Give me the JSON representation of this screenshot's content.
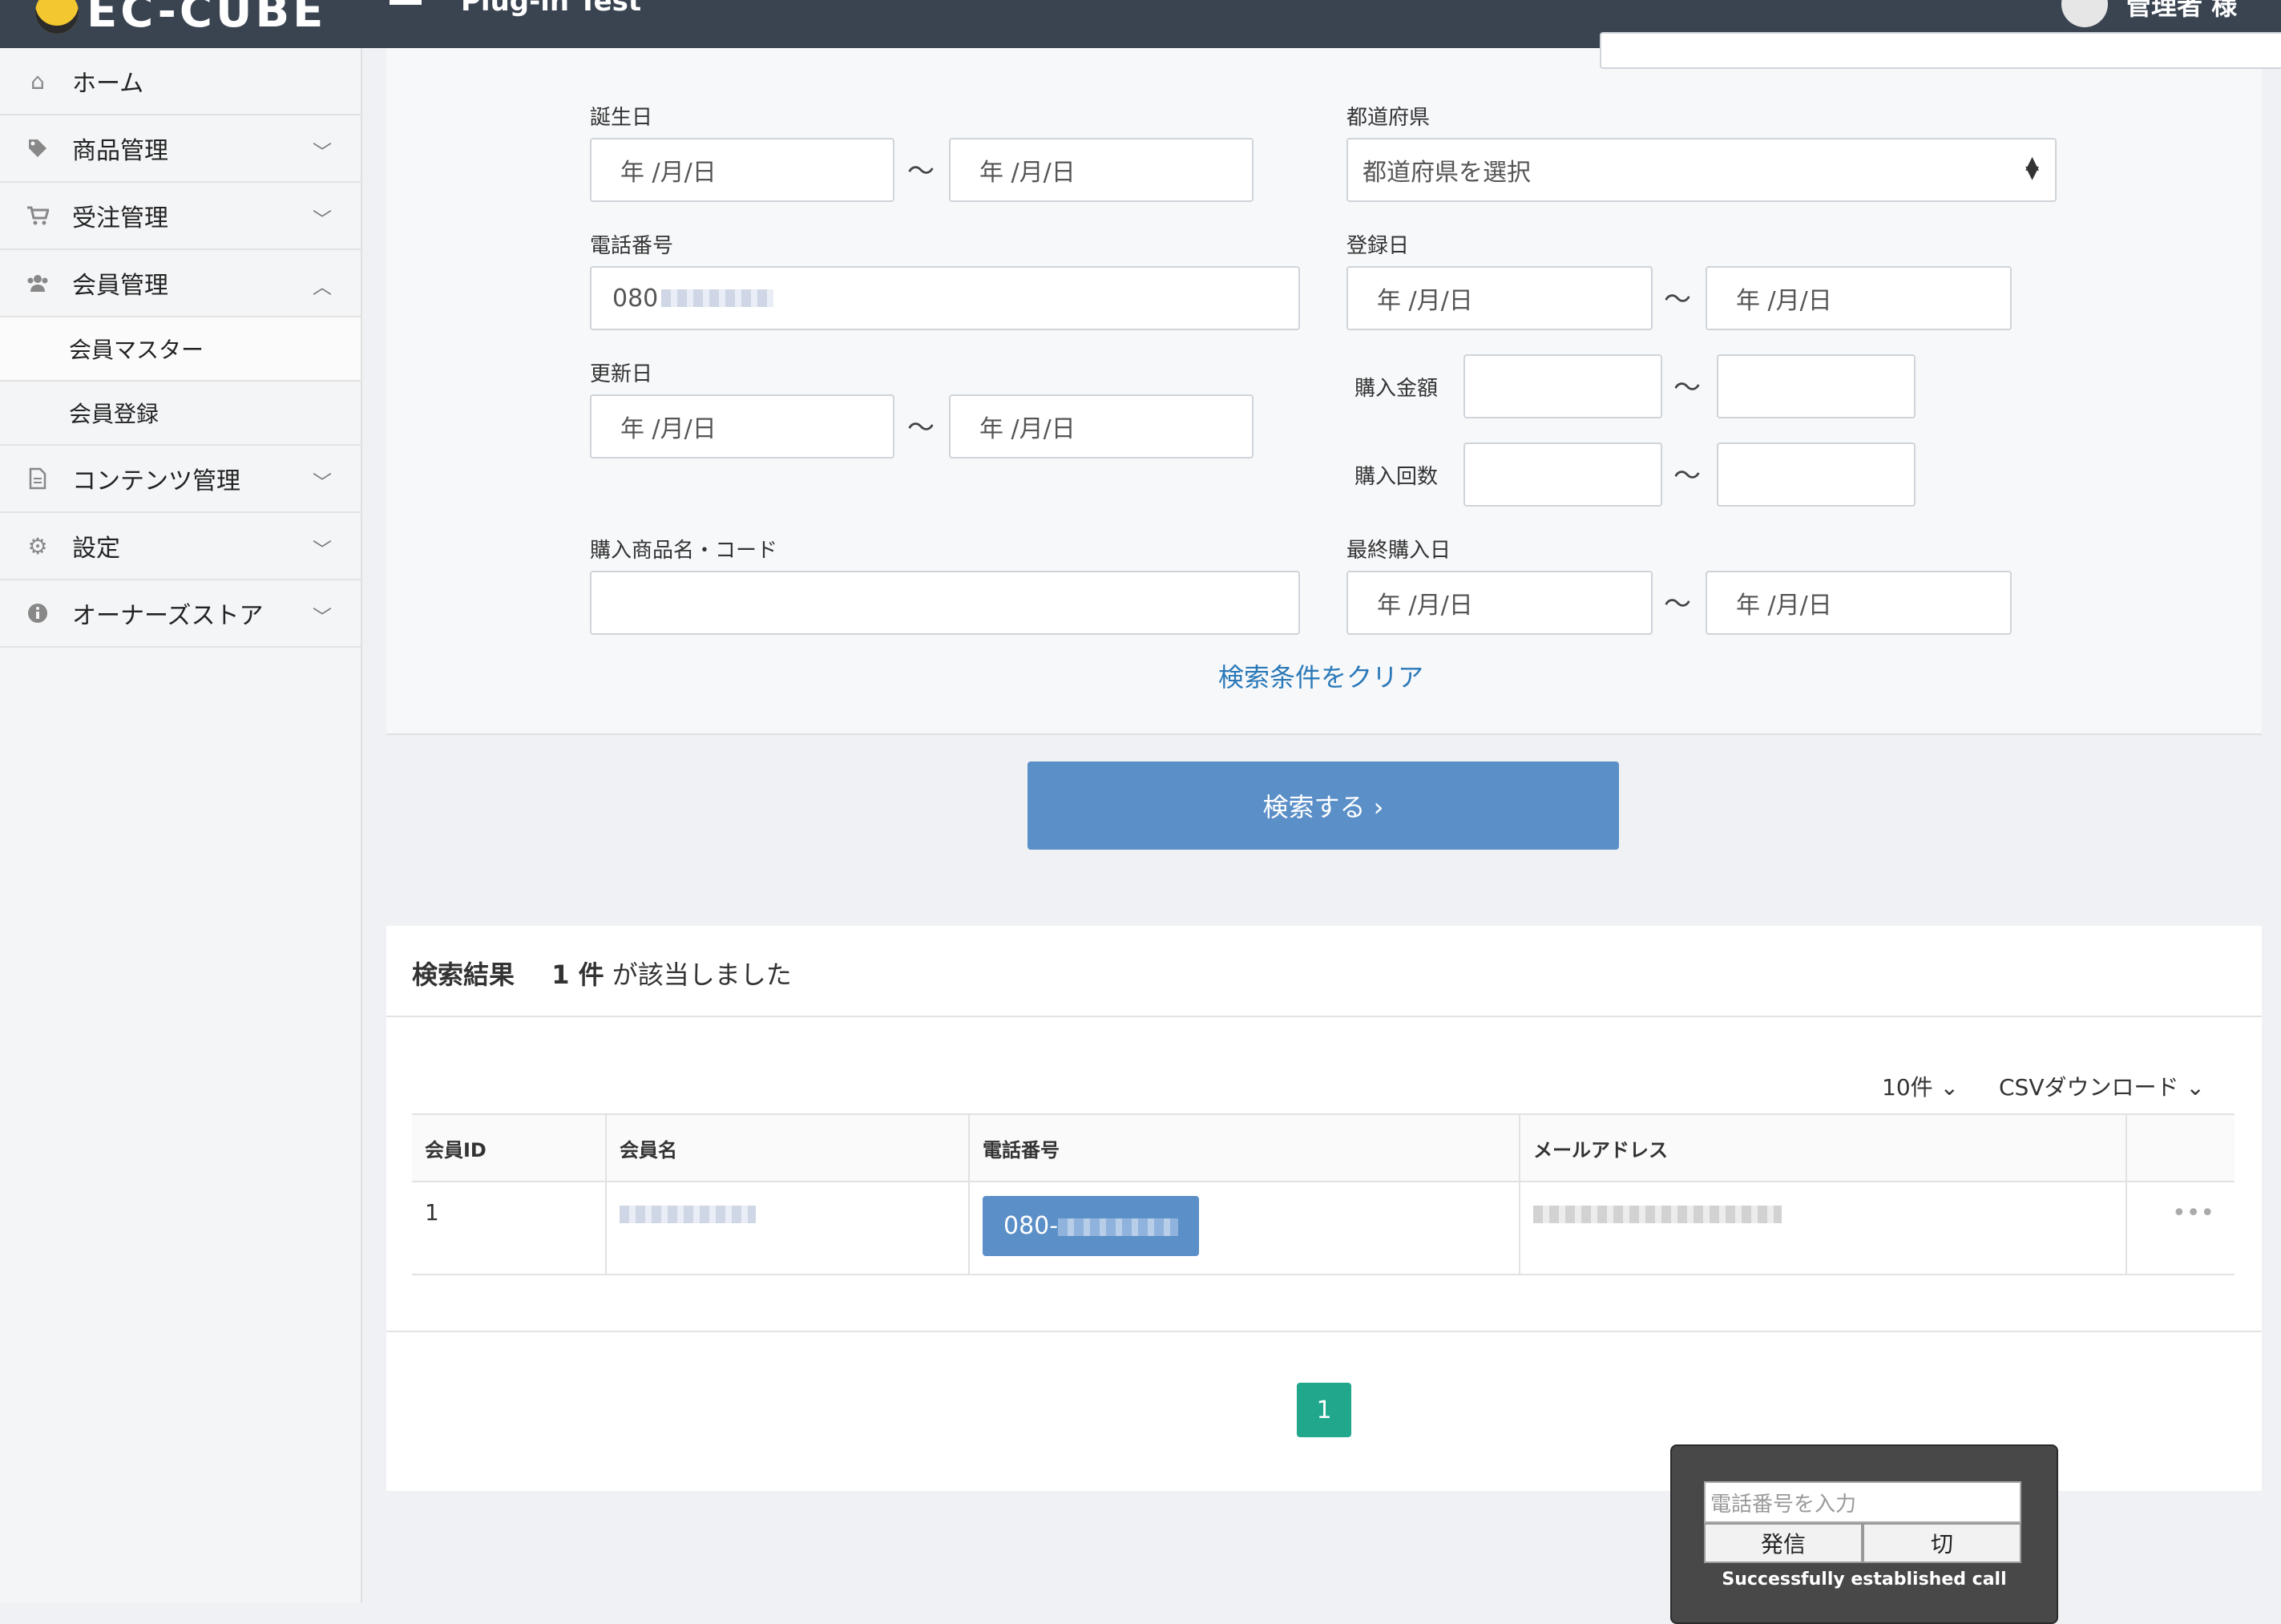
{
  "header": {
    "brand": "EC-CUBE",
    "title": "Plug-in Test",
    "user": "管理者 様"
  },
  "sidebar": {
    "items": [
      {
        "label": "ホーム",
        "icon": "home-icon"
      },
      {
        "label": "商品管理",
        "icon": "tag-icon"
      },
      {
        "label": "受注管理",
        "icon": "cart-icon"
      },
      {
        "label": "会員管理",
        "icon": "users-icon"
      },
      {
        "label": "コンテンツ管理",
        "icon": "document-icon"
      },
      {
        "label": "設定",
        "icon": "gear-icon"
      },
      {
        "label": "オーナーズストア",
        "icon": "info-icon"
      }
    ],
    "sub_items": [
      {
        "label": "会員マスター"
      },
      {
        "label": "会員登録"
      }
    ]
  },
  "search": {
    "birthday_label": "誕生日",
    "date_placeholder": "年 /月/日",
    "prefecture_label": "都道府県",
    "prefecture_value": "都道府県を選択",
    "phone_label": "電話番号",
    "phone_value": "080",
    "registered_label": "登録日",
    "updated_label": "更新日",
    "purchase_amount_label": "購入金額",
    "purchase_count_label": "購入回数",
    "product_label": "購入商品名・コード",
    "last_purchase_label": "最終購入日",
    "tilde": "〜",
    "clear_link": "検索条件をクリア",
    "search_button": "検索する ›"
  },
  "results": {
    "title": "検索結果",
    "count": "1 件",
    "suffix": "が該当しました",
    "per_page": "10件 ⌄",
    "csv": "CSVダウンロード ⌄",
    "columns": [
      "会員ID",
      "会員名",
      "電話番号",
      "メールアドレス",
      ""
    ],
    "rows": [
      {
        "id": "1",
        "phone": "080-"
      }
    ],
    "page": "1"
  },
  "phone_widget": {
    "placeholder": "電話番号を入力",
    "call_button": "発信",
    "hangup_button": "切",
    "status": "Successfully established call"
  }
}
